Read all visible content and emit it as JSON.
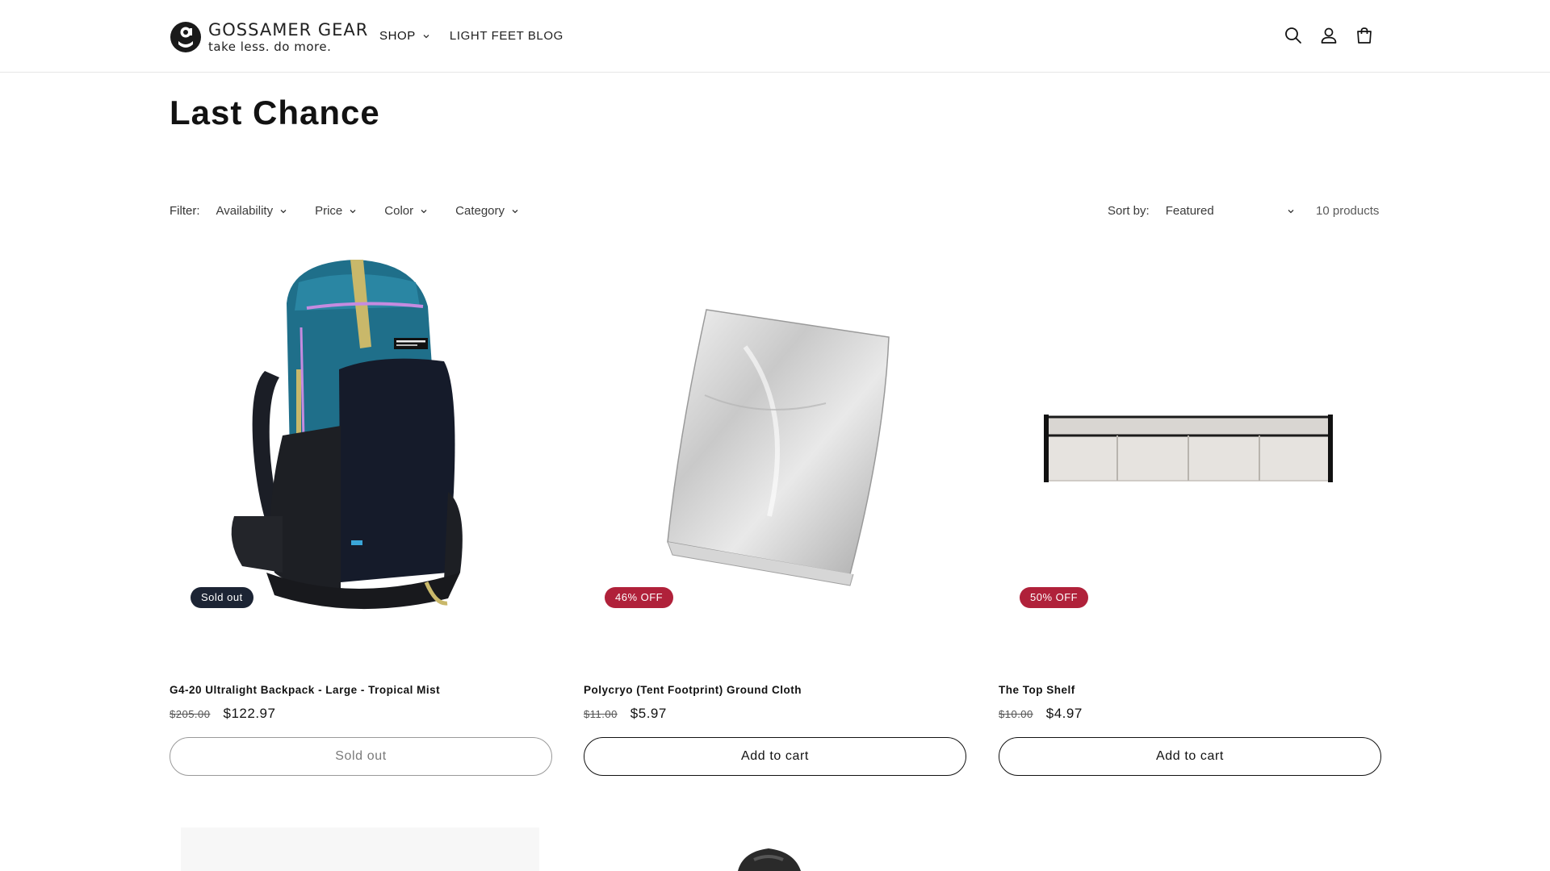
{
  "brand": {
    "name": "GOSSAMER GEAR",
    "tagline": "take less. do more."
  },
  "nav": {
    "shop_label": "SHOP",
    "blog_label": "LIGHT FEET BLOG"
  },
  "header_icons": [
    "search-icon",
    "account-icon",
    "cart-icon"
  ],
  "page": {
    "title": "Last Chance"
  },
  "filters": {
    "label": "Filter:",
    "items": [
      "Availability",
      "Price",
      "Color",
      "Category"
    ]
  },
  "sort": {
    "label": "Sort by:",
    "selected": "Featured"
  },
  "product_count": "10 products",
  "colors": {
    "soldout_badge": "#1c2434",
    "sale_badge": "#b0213a",
    "text": "#121212"
  },
  "products": [
    {
      "title": "G4-20 Ultralight Backpack - Large - Tropical Mist",
      "price_old": "$205.00",
      "price_new": "$122.97",
      "badge": "Sold out",
      "button": "Sold out"
    },
    {
      "title": "Polycryo (Tent Footprint) Ground Cloth",
      "price_old": "$11.00",
      "price_new": "$5.97",
      "badge": "46% OFF",
      "button": "Add to cart"
    },
    {
      "title": "The Top Shelf",
      "price_old": "$10.00",
      "price_new": "$4.97",
      "badge": "50% OFF",
      "button": "Add to cart"
    }
  ]
}
